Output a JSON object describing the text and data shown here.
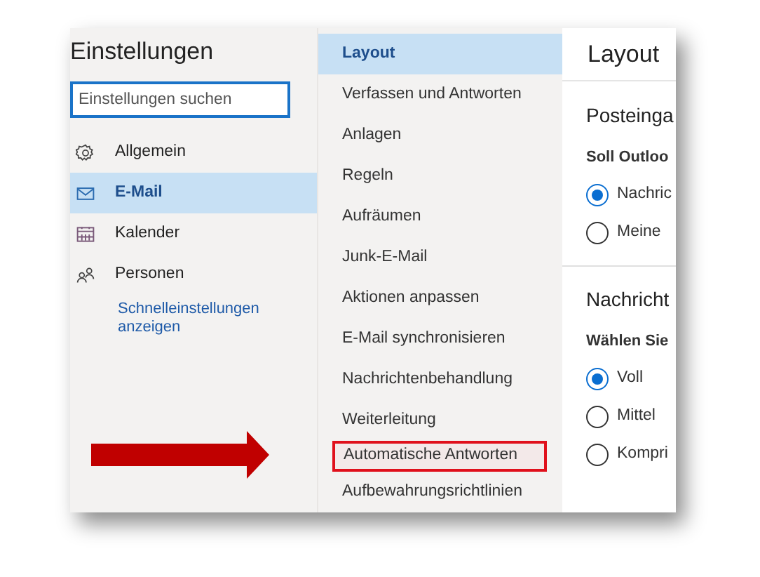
{
  "sidebar": {
    "title": "Einstellungen",
    "search": {
      "placeholder": "Einstellungen suchen"
    },
    "items": [
      {
        "label": "Allgemein",
        "kind": "gear",
        "selected": false
      },
      {
        "label": "E-Mail",
        "kind": "mail",
        "selected": true
      },
      {
        "label": "Kalender",
        "kind": "calendar",
        "selected": false
      },
      {
        "label": "Personen",
        "kind": "people",
        "selected": false
      }
    ],
    "link": "Schnelleinstellungen anzeigen"
  },
  "submenu": {
    "items": [
      {
        "label": "Layout",
        "selected": true,
        "highlighted": false
      },
      {
        "label": "Verfassen und Antworten",
        "selected": false,
        "highlighted": false
      },
      {
        "label": "Anlagen",
        "selected": false,
        "highlighted": false
      },
      {
        "label": "Regeln",
        "selected": false,
        "highlighted": false
      },
      {
        "label": "Aufräumen",
        "selected": false,
        "highlighted": false
      },
      {
        "label": "Junk-E-Mail",
        "selected": false,
        "highlighted": false
      },
      {
        "label": "Aktionen anpassen",
        "selected": false,
        "highlighted": false
      },
      {
        "label": "E-Mail synchronisieren",
        "selected": false,
        "highlighted": false
      },
      {
        "label": "Nachrichtenbehandlung",
        "selected": false,
        "highlighted": false
      },
      {
        "label": "Weiterleitung",
        "selected": false,
        "highlighted": false
      },
      {
        "label": "Automatische Antworten",
        "selected": false,
        "highlighted": true
      },
      {
        "label": "Aufbewahrungsrichtlinien",
        "selected": false,
        "highlighted": false
      }
    ]
  },
  "content": {
    "title": "Layout",
    "sections": [
      {
        "heading": "Posteinga",
        "question": "Soll Outloo",
        "options": [
          {
            "label": "Nachric",
            "selected": true
          },
          {
            "label": "Meine",
            "selected": false
          }
        ]
      },
      {
        "heading": "Nachricht",
        "question": "Wählen Sie",
        "options": [
          {
            "label": "Voll",
            "selected": true
          },
          {
            "label": "Mittel",
            "selected": false
          },
          {
            "label": "Kompri",
            "selected": false
          }
        ]
      }
    ]
  }
}
